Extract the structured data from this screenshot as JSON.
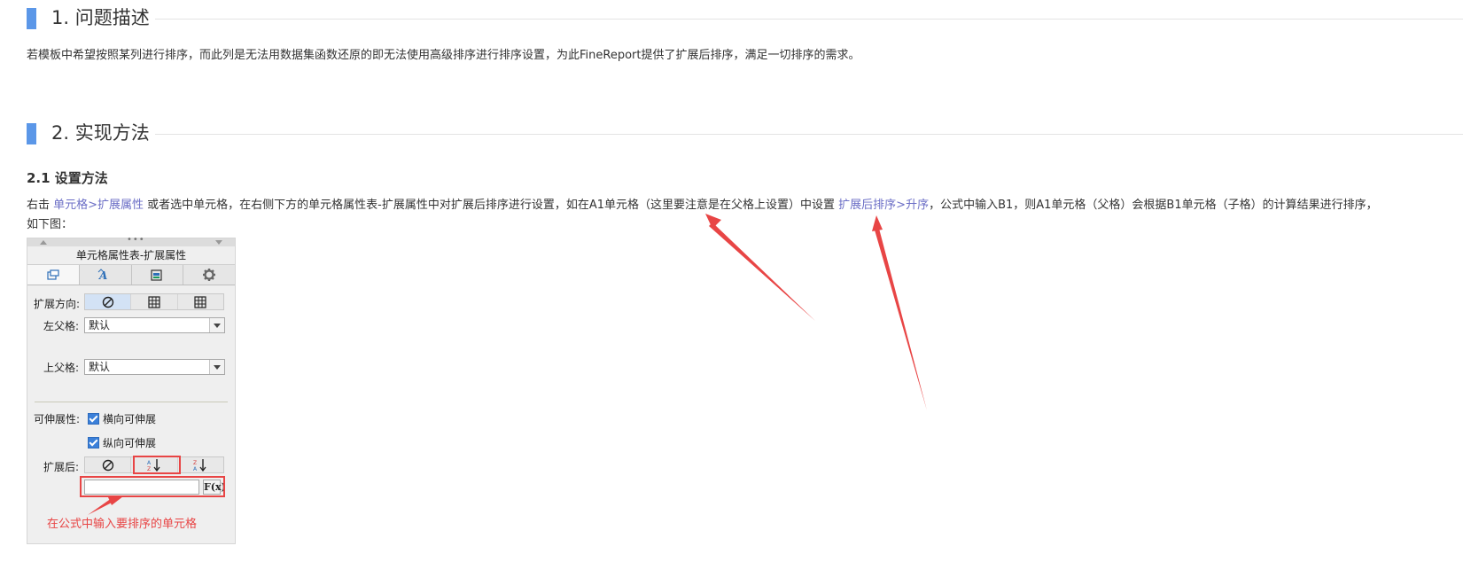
{
  "sections": [
    {
      "title": "1. 问题描述"
    },
    {
      "title": "2. 实现方法"
    }
  ],
  "problem_text": "若模板中希望按照某列进行排序，而此列是无法用数据集函数还原的即无法使用高级排序进行排序设置，为此FineReport提供了扩展后排序，满足一切排序的需求。",
  "subsection": "2.1 设置方法",
  "method": {
    "part1": "右击 ",
    "link1": "单元格>扩展属性",
    "part2": " 或者选中单元格，在右侧下方的单元格属性表-扩展属性中对扩展后排序进行设置，如在A1单元格（这里要注意是在父格上设置）中设置 ",
    "link2": "扩展后排序>升序",
    "part3": "，公式中输入B1，则A1单元格（父格）会根据B1单元格（子格）的计算结果进行排序，如下图："
  },
  "panel": {
    "title": "单元格属性表-扩展属性",
    "expand_direction_label": "扩展方向:",
    "left_parent_label": "左父格:",
    "left_parent_value": "默认",
    "top_parent_label": "上父格:",
    "top_parent_value": "默认",
    "stretch_label": "可伸展性:",
    "horizontal_stretch": "横向可伸展",
    "vertical_stretch": "纵向可伸展",
    "after_expand_label": "扩展后:",
    "fx_label": "F(x)",
    "tab_icons": [
      "cell-icon",
      "font-style-icon",
      "widget-icon",
      "gear-icon"
    ]
  },
  "annotation_caption": "在公式中输入要排序的单元格",
  "accent_colors": {
    "section_bar": "#5b97e8",
    "link": "#6b6ec6",
    "annotation": "#e84545"
  }
}
